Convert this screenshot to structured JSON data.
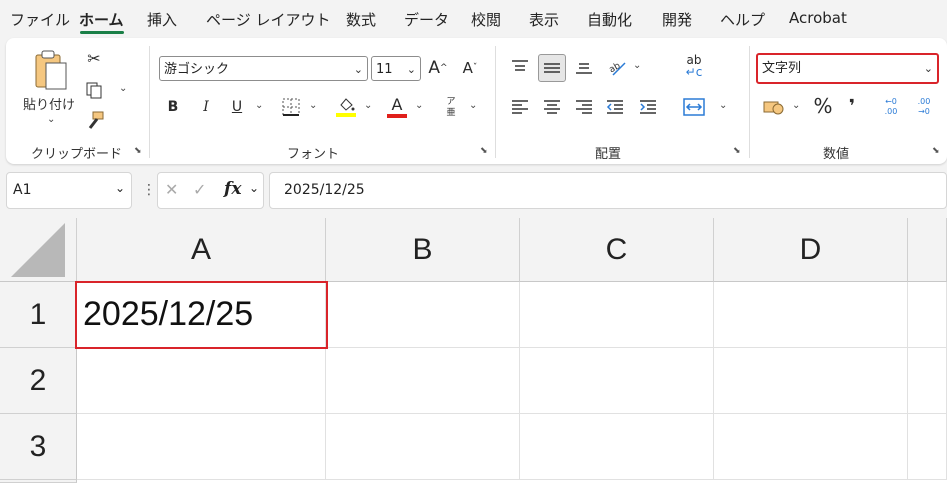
{
  "tabs": [
    {
      "label": "ファイル",
      "active": false
    },
    {
      "label": "ホーム",
      "active": true
    },
    {
      "label": "挿入",
      "active": false
    },
    {
      "label": "ページ レイアウト",
      "active": false
    },
    {
      "label": "数式",
      "active": false
    },
    {
      "label": "データ",
      "active": false
    },
    {
      "label": "校閲",
      "active": false
    },
    {
      "label": "表示",
      "active": false
    },
    {
      "label": "自動化",
      "active": false
    },
    {
      "label": "開発",
      "active": false
    },
    {
      "label": "ヘルプ",
      "active": false
    },
    {
      "label": "Acrobat",
      "active": false
    }
  ],
  "ribbon": {
    "clipboard": {
      "label": "クリップボード",
      "paste_label": "貼り付け"
    },
    "font": {
      "label": "フォント",
      "font_name": "游ゴシック",
      "font_size": "11",
      "phonetic_top": "ア",
      "phonetic_bottom": "亜"
    },
    "alignment": {
      "label": "配置",
      "wrap_text": "ab"
    },
    "number": {
      "label": "数値",
      "format": "文字列",
      "percent": "%",
      "comma": "❜",
      "inc_decimal": "←0 .00",
      "dec_decimal": ".00 →0"
    },
    "colors": {
      "highlight": "#ffff00",
      "font_color": "#e0201b",
      "accent": "#1a7f47",
      "highlight_border": "#d9242a"
    }
  },
  "formula_bar": {
    "name_box": "A1",
    "fx": "fx",
    "value": "2025/12/25"
  },
  "grid": {
    "columns": [
      "A",
      "B",
      "C",
      "D"
    ],
    "rows": [
      "1",
      "2",
      "3"
    ],
    "a1_value": "2025/12/25"
  }
}
